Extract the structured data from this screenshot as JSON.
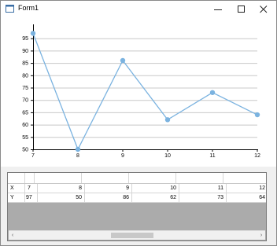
{
  "window": {
    "title": "Form1",
    "minimize_icon": "minimize-icon",
    "maximize_icon": "maximize-icon",
    "close_icon": "close-icon"
  },
  "chart_data": {
    "type": "line",
    "x": [
      7,
      8,
      9,
      10,
      11,
      12
    ],
    "series": [
      {
        "values": [
          97,
          50,
          86,
          62,
          73,
          64
        ]
      }
    ],
    "xlim": [
      7,
      12
    ],
    "ylim": [
      50,
      100
    ],
    "x_ticks": [
      "7",
      "8",
      "9",
      "10",
      "11",
      "12"
    ],
    "y_ticks": [
      "50",
      "55",
      "60",
      "65",
      "70",
      "75",
      "80",
      "85",
      "90",
      "95"
    ],
    "grid": true,
    "color": "#7bb3e0"
  },
  "grid": {
    "rows": [
      {
        "label": "X",
        "values": [
          "7",
          "8",
          "9",
          "10",
          "11",
          "12"
        ]
      },
      {
        "label": "Y",
        "values": [
          "97",
          "50",
          "86",
          "62",
          "73",
          "64"
        ]
      }
    ]
  },
  "scrollbar": {
    "left_arrow": "‹",
    "right_arrow": "›"
  }
}
